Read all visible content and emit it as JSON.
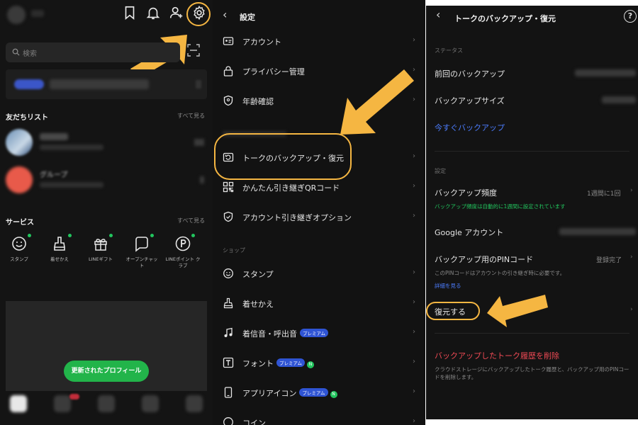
{
  "panel1": {
    "search_placeholder": "検索",
    "friends_title": "友だちリスト",
    "friends_see_all": "すべて見る",
    "services_title": "サービス",
    "services_see_all": "すべて見る",
    "services": [
      {
        "label": "スタンプ",
        "icon": "smiley-icon"
      },
      {
        "label": "着せかえ",
        "icon": "brush-icon"
      },
      {
        "label": "LINEギフト",
        "icon": "gift-icon"
      },
      {
        "label": "オープンチャット",
        "icon": "chat-bubble-icon"
      },
      {
        "label": "LINEポイント クラブ",
        "icon": "points-icon"
      }
    ],
    "profile_button": "更新されたプロフィール",
    "friend2_name": "グループ",
    "accent_green": "#22b44a",
    "highlight_color": "#f5b642"
  },
  "panel2": {
    "title": "設定",
    "rows": [
      {
        "label": "アカウント",
        "icon": "account-card-icon"
      },
      {
        "label": "プライバシー管理",
        "icon": "lock-icon"
      },
      {
        "label": "年齢確認",
        "icon": "shield-check-icon"
      },
      {
        "label": "トークのバックアップ・復元",
        "icon": "backup-icon"
      },
      {
        "label": "かんたん引き継ぎQRコード",
        "icon": "qr-code-icon"
      },
      {
        "label": "アカウント引き継ぎオプション",
        "icon": "shield-icon"
      }
    ],
    "shop_section": "ショップ",
    "shop_rows": [
      {
        "label": "スタンプ",
        "icon": "smiley-icon"
      },
      {
        "label": "着せかえ",
        "icon": "brush-icon"
      },
      {
        "label": "着信音・呼出音",
        "icon": "music-note-icon",
        "pill": "プレミアム"
      },
      {
        "label": "フォント",
        "icon": "font-icon",
        "pill": "プレミアム",
        "new": "N"
      },
      {
        "label": "アプリアイコン",
        "icon": "phone-icon",
        "pill": "プレミアム",
        "new": "N"
      },
      {
        "label": "コイン",
        "icon": "coin-icon"
      }
    ]
  },
  "panel3": {
    "title": "トークのバックアップ・復元",
    "status_section": "ステータス",
    "last_backup": "前回のバックアップ",
    "backup_size": "バックアップサイズ",
    "backup_now": "今すぐバックアップ",
    "settings_section": "設定",
    "backup_frequency": "バックアップ頻度",
    "backup_frequency_value": "1週間に1回",
    "frequency_note": "バックアップ頻度は自動的に1週間に設定されています",
    "google_account": "Google アカウント",
    "pin_code": "バックアップ用のPINコード",
    "pin_status": "登録完了",
    "pin_note": "このPINコードはアカウントの引き継ぎ時に必要です。",
    "see_details": "詳細を見る",
    "restore": "復元する",
    "delete_history": "バックアップしたトーク履歴を削除",
    "delete_note": "クラウドストレージにバックアップしたトーク履歴と、バックアップ用のPINコードを削除します。"
  }
}
